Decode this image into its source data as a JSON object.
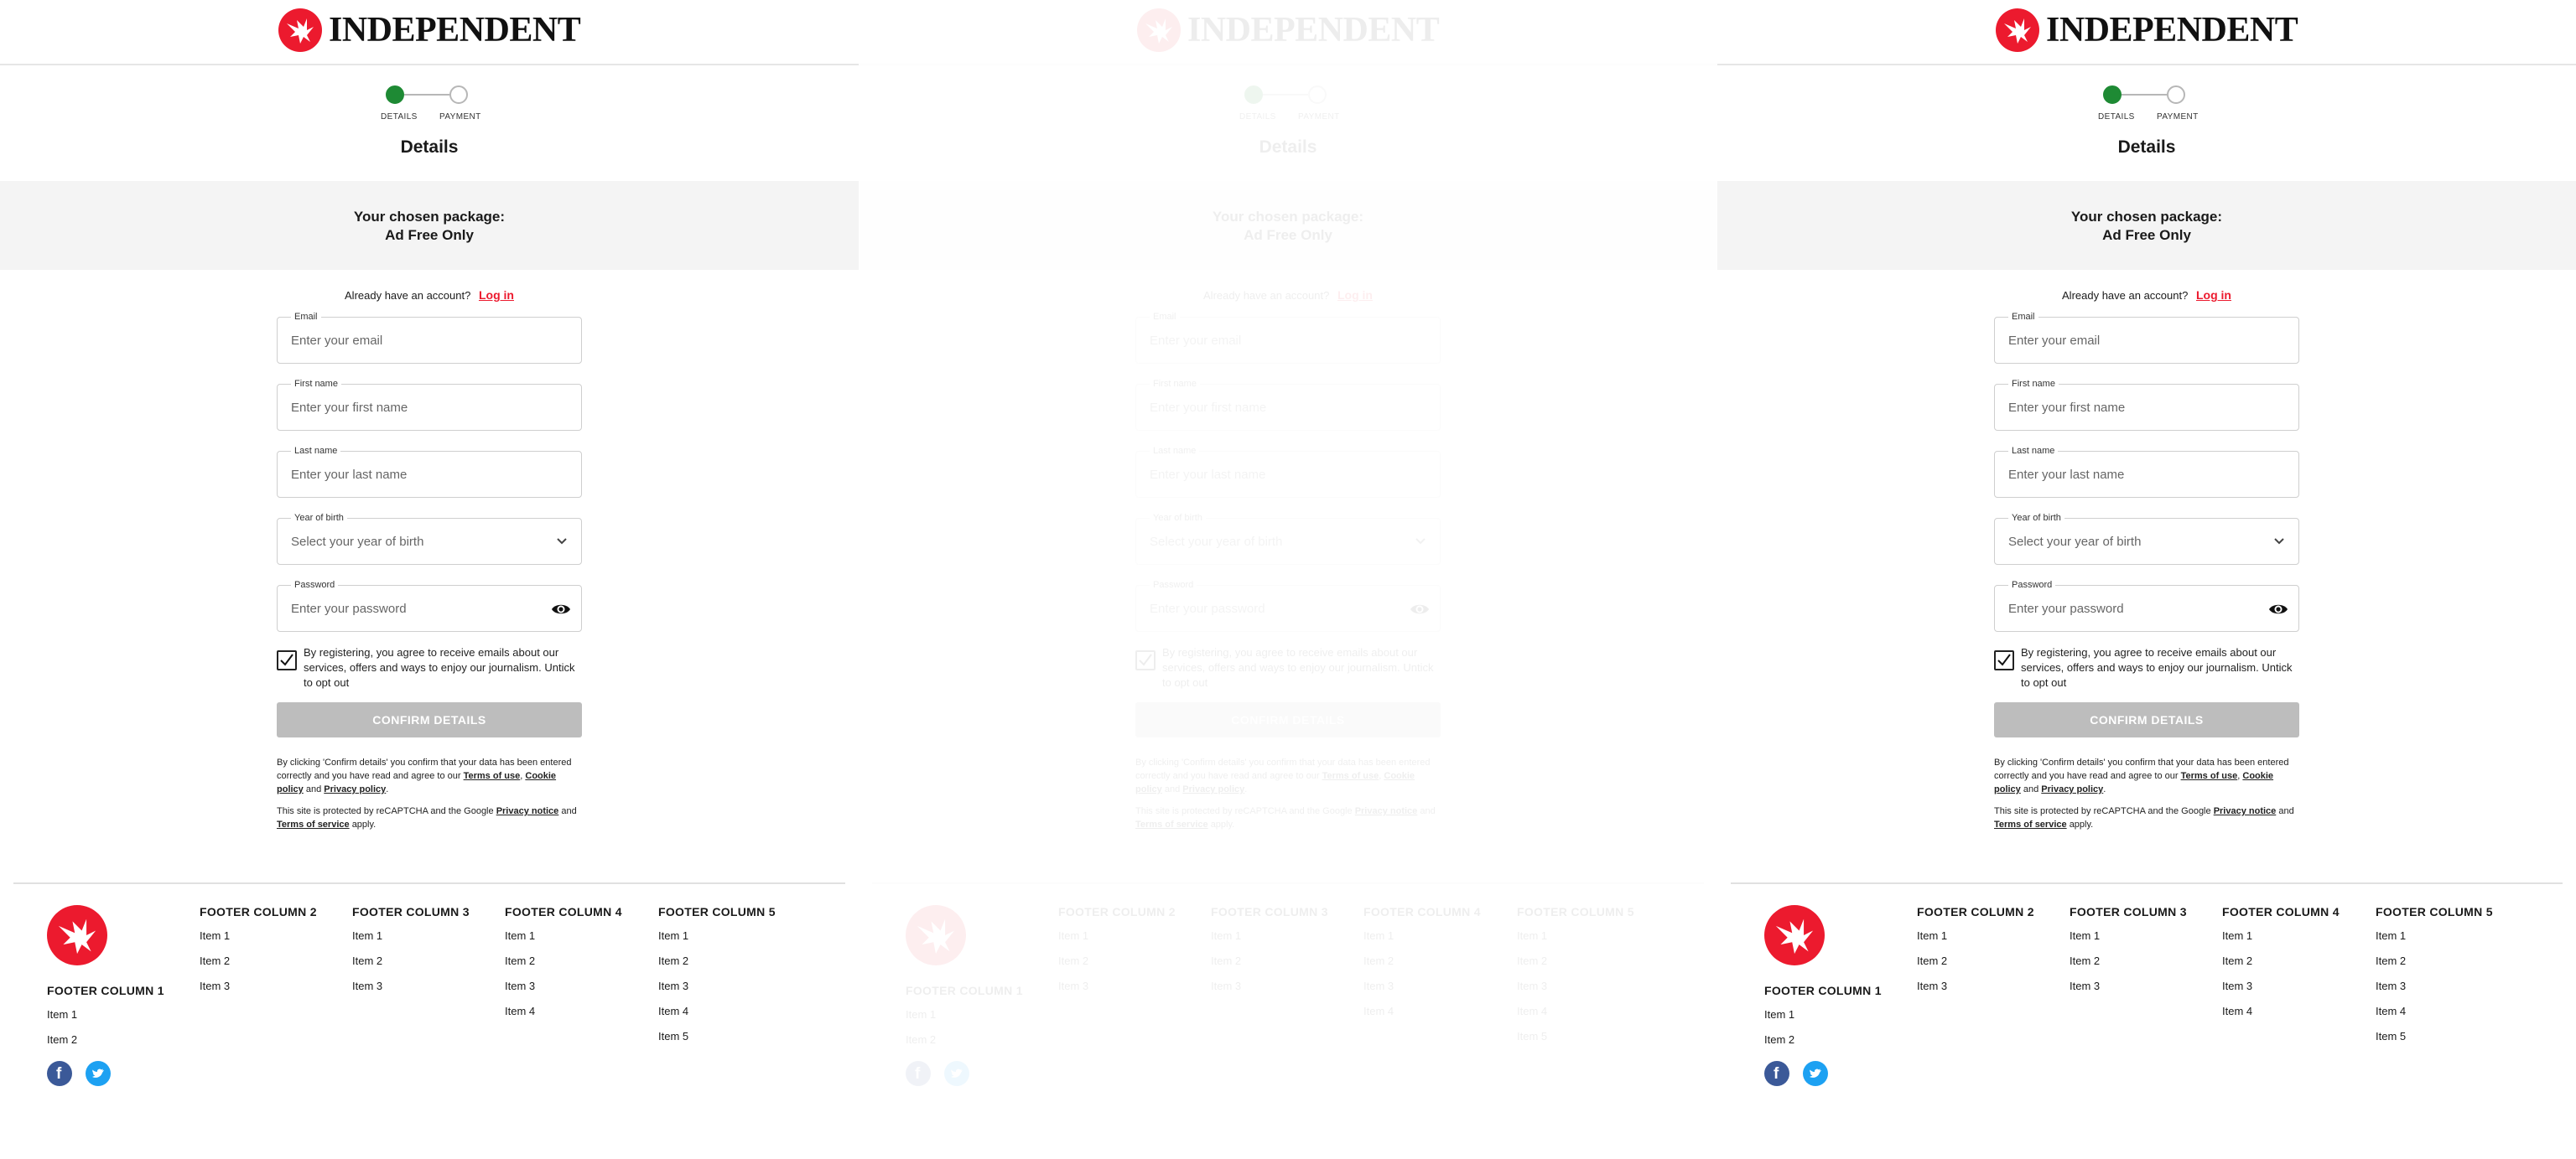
{
  "brand": {
    "name": "INDEPENDENT",
    "accent": "#ec1a2e",
    "step_active": "#1e8a34"
  },
  "progress": {
    "steps": [
      "DETAILS",
      "PAYMENT"
    ],
    "current": 1
  },
  "page": {
    "title": "Details"
  },
  "package": {
    "heading": "Your chosen package:",
    "name": "Ad Free Only"
  },
  "account": {
    "prompt": "Already have an account?",
    "login_link": "Log in"
  },
  "fields": {
    "email": {
      "label": "Email",
      "placeholder": "Enter your email"
    },
    "first_name": {
      "label": "First name",
      "placeholder": "Enter your first name"
    },
    "last_name": {
      "label": "Last name",
      "placeholder": "Enter your last name"
    },
    "year_of_birth": {
      "label": "Year of birth",
      "placeholder": "Select your year of birth"
    },
    "password": {
      "label": "Password",
      "placeholder": "Enter your password"
    }
  },
  "consent": {
    "checked": true,
    "text": "By registering, you agree to receive emails about our services, offers and ways to enjoy our journalism. Untick to opt out"
  },
  "confirm_button": "CONFIRM DETAILS",
  "legal": {
    "p1_a": "By clicking 'Confirm details' you confirm that your data has been entered correctly and you have read and agree to our",
    "terms_of_use": "Terms of use",
    "cookie_policy": "Cookie policy",
    "and": "and",
    "privacy_policy": "Privacy policy",
    "p2_a": "This site is protected by reCAPTCHA and the Google",
    "privacy_notice": "Privacy notice",
    "terms_of_service": "Terms of service",
    "apply": "apply."
  },
  "footer": {
    "columns": [
      {
        "title": "FOOTER COLUMN 1",
        "items": [
          "Item 1",
          "Item 2"
        ]
      },
      {
        "title": "FOOTER COLUMN 2",
        "items": [
          "Item 1",
          "Item 2",
          "Item 3"
        ]
      },
      {
        "title": "FOOTER COLUMN 3",
        "items": [
          "Item 1",
          "Item 2",
          "Item 3"
        ]
      },
      {
        "title": "FOOTER COLUMN 4",
        "items": [
          "Item 1",
          "Item 2",
          "Item 3",
          "Item 4"
        ]
      },
      {
        "title": "FOOTER COLUMN 5",
        "items": [
          "Item 1",
          "Item 2",
          "Item 3",
          "Item 4",
          "Item 5"
        ]
      }
    ],
    "social": [
      "facebook-icon",
      "twitter-icon"
    ]
  }
}
